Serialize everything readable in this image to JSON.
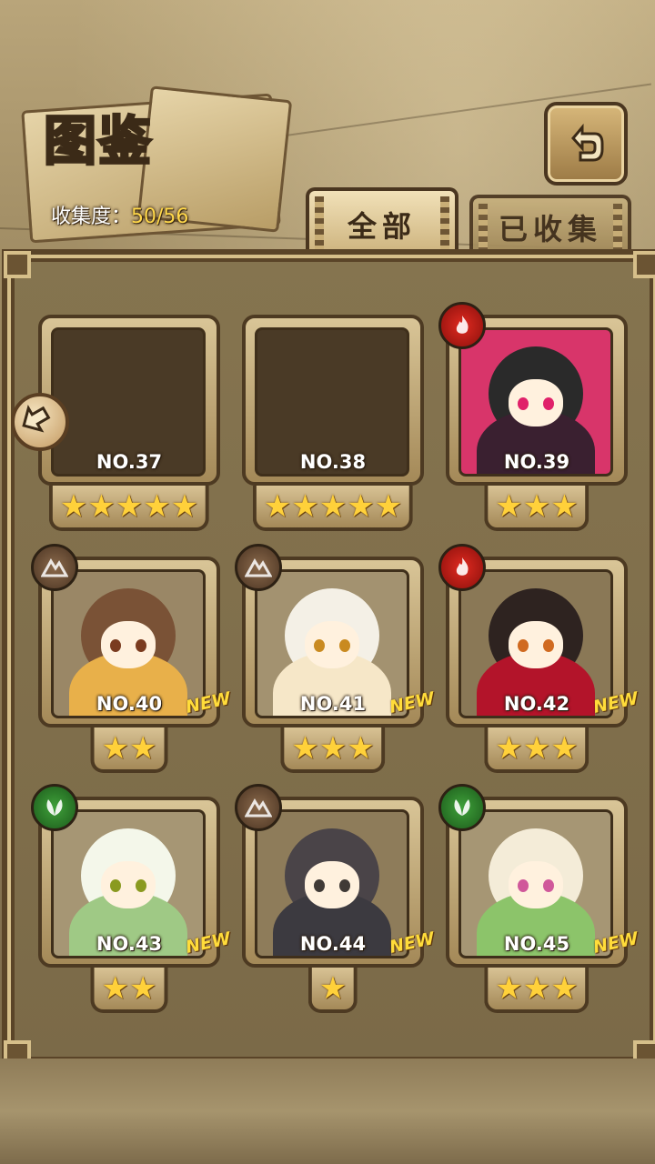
{
  "header": {
    "title": "图鉴",
    "collection_label": "收集度：",
    "collection_value": "50/56"
  },
  "tabs": [
    {
      "label": "全部",
      "selected": true
    },
    {
      "label": "已收集",
      "selected": false
    }
  ],
  "cards": [
    {
      "no": "NO.37",
      "stars": "★★★★★",
      "locked": true,
      "element": "",
      "new": ""
    },
    {
      "no": "NO.38",
      "stars": "★★★★★",
      "locked": true,
      "element": "",
      "new": ""
    },
    {
      "no": "NO.39",
      "stars": "★★★",
      "locked": false,
      "element": "fire",
      "new": ""
    },
    {
      "no": "NO.40",
      "stars": "★★",
      "locked": false,
      "element": "earth",
      "new": "NEW"
    },
    {
      "no": "NO.41",
      "stars": "★★★",
      "locked": false,
      "element": "earth",
      "new": "NEW"
    },
    {
      "no": "NO.42",
      "stars": "★★★",
      "locked": false,
      "element": "fire",
      "new": "NEW"
    },
    {
      "no": "NO.43",
      "stars": "★★",
      "locked": false,
      "element": "leaf",
      "new": "NEW"
    },
    {
      "no": "NO.44",
      "stars": "★",
      "locked": false,
      "element": "earth",
      "new": "NEW"
    },
    {
      "no": "NO.45",
      "stars": "★★★",
      "locked": false,
      "element": "leaf",
      "new": "NEW"
    }
  ],
  "icons": {
    "back": "back-arrow-icon",
    "prev_page": "left-arrow-icon",
    "fire": "fire-element-icon",
    "earth": "earth-element-icon",
    "leaf": "leaf-element-icon"
  },
  "colors": {
    "accent_yellow": "#ffd84a",
    "fire": "#d3231b",
    "earth": "#6b4f36",
    "leaf": "#2f8a2c"
  }
}
